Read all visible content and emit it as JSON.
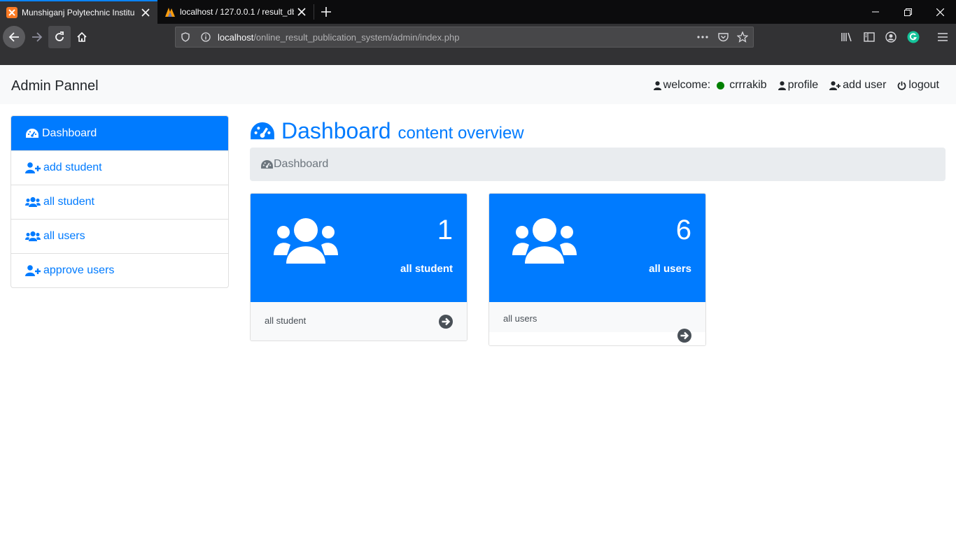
{
  "browser": {
    "tabs": [
      {
        "title": "Munshiganj Polytechnic Institu"
      },
      {
        "title": "localhost / 127.0.0.1 / result_db"
      }
    ],
    "url": {
      "host": "localhost",
      "path": "/online_result_publication_system/admin/index.php"
    }
  },
  "page": {
    "brand": "Admin Pannel",
    "nav": {
      "welcome_label": "welcome:",
      "username": "crrrakib",
      "profile": "profile",
      "add_user": "add user",
      "logout": "logout",
      "online_color": "#008000"
    },
    "sidebar": {
      "items": [
        {
          "label": "Dashboard",
          "icon": "dashboard-icon",
          "active": true
        },
        {
          "label": "add student",
          "icon": "user-plus-icon"
        },
        {
          "label": "all student",
          "icon": "users-icon"
        },
        {
          "label": "all users",
          "icon": "users-icon"
        },
        {
          "label": "approve users",
          "icon": "user-plus-icon"
        }
      ]
    },
    "heading": {
      "title": "Dashboard",
      "subtitle": "content overview"
    },
    "breadcrumb": {
      "label": "Dashboard"
    },
    "cards": [
      {
        "count": "1",
        "label": "all student",
        "footer": "all student"
      },
      {
        "count": "6",
        "label": "all users",
        "footer": "all users"
      }
    ],
    "colors": {
      "primary": "#007bff",
      "light": "#f8f9fa",
      "breadcrumb_bg": "#e9ecef"
    }
  }
}
